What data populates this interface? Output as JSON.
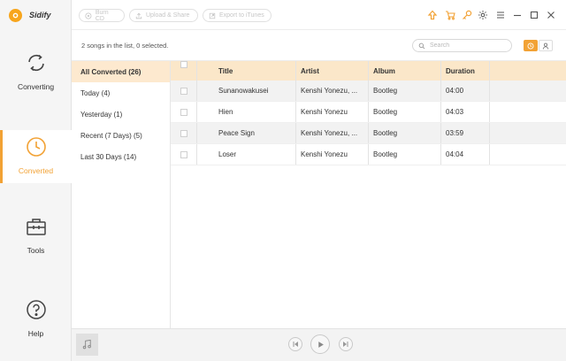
{
  "app": {
    "name": "Sidify"
  },
  "nav": [
    {
      "label": "Converting",
      "icon": "refresh-icon"
    },
    {
      "label": "Converted",
      "icon": "clock-icon"
    },
    {
      "label": "Tools",
      "icon": "toolbox-icon"
    },
    {
      "label": "Help",
      "icon": "help-icon"
    }
  ],
  "toolbar": {
    "burn": "Burn CD",
    "upload": "Upload & Share",
    "export": "Export to iTunes",
    "icons": [
      "upgrade-arrow-icon",
      "cart-icon",
      "key-icon",
      "gear-icon",
      "menu-icon",
      "minimize-icon",
      "maximize-icon",
      "close-icon"
    ]
  },
  "status": {
    "text": "2 songs in the list, 0 selected.",
    "search_placeholder": "Search"
  },
  "filters": [
    "All Converted (26)",
    "Today (4)",
    "Yesterday (1)",
    "Recent (7 Days) (5)",
    "Last 30 Days (14)"
  ],
  "table": {
    "headers": {
      "title": "Title",
      "artist": "Artist",
      "album": "Album",
      "duration": "Duration"
    },
    "rows": [
      {
        "title": "Sunanowakusei",
        "artist": "Kenshi Yonezu, ...",
        "album": "Bootleg",
        "duration": "04:00"
      },
      {
        "title": "Hien",
        "artist": "Kenshi Yonezu",
        "album": "Bootleg",
        "duration": "04:03"
      },
      {
        "title": "Peace Sign",
        "artist": "Kenshi Yonezu, ...",
        "album": "Bootleg",
        "duration": "03:59"
      },
      {
        "title": "Loser",
        "artist": "Kenshi Yonezu",
        "album": "Bootleg",
        "duration": "04:04"
      }
    ]
  },
  "colors": {
    "accent": "#f2a235",
    "header_bg": "#fbe7c9",
    "active_filter_bg": "#fde9cf"
  }
}
